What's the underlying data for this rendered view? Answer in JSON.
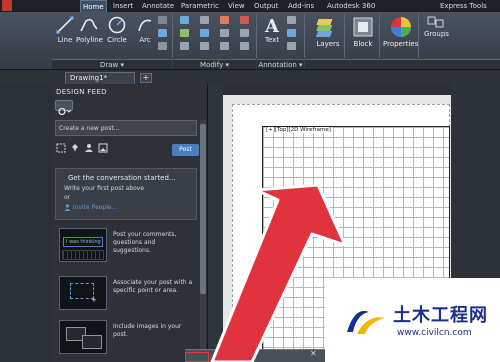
{
  "ribbon_tabs": [
    "Home",
    "Insert",
    "Annotate",
    "Parametric",
    "View",
    "Output",
    "Add-ins",
    "Autodesk 360",
    "Express Tools"
  ],
  "active_tab": "Home",
  "tools": {
    "line": "Line",
    "polyline": "Polyline",
    "circle": "Circle",
    "arc": "Arc",
    "text": "Text",
    "layers": "Layers",
    "block": "Block",
    "properties": "Properties",
    "groups": "Groups"
  },
  "panels": {
    "draw": "Draw ▾",
    "modify": "Modify ▾",
    "annotation": "Annotation ▾"
  },
  "document_tab": "Drawing1*",
  "new_tab": "+",
  "feed": {
    "title": "DESIGN FEED",
    "new_post_placeholder": "Create a new post...",
    "post_button": "Post",
    "start_title": "Get the conversation started...",
    "start_sub": "Write your first post above",
    "start_or": "or",
    "invite": "Invite People...",
    "tips": [
      {
        "image": "I was thinking",
        "text": "Post your comments, questions and suggestions."
      },
      {
        "image": "",
        "text": "Associate your post with a specific point or area."
      },
      {
        "image": "",
        "text": "Include images in your post."
      }
    ]
  },
  "viewport_label": "[+][Top][2D Wireframe]",
  "command_close": "✕",
  "watermark": {
    "title": "土木工程网",
    "url": "www.civilcn.com"
  },
  "colors": {
    "arrow": "#e0333d",
    "accent": "#4a7fc0",
    "watermark": "#1d2f8e"
  }
}
